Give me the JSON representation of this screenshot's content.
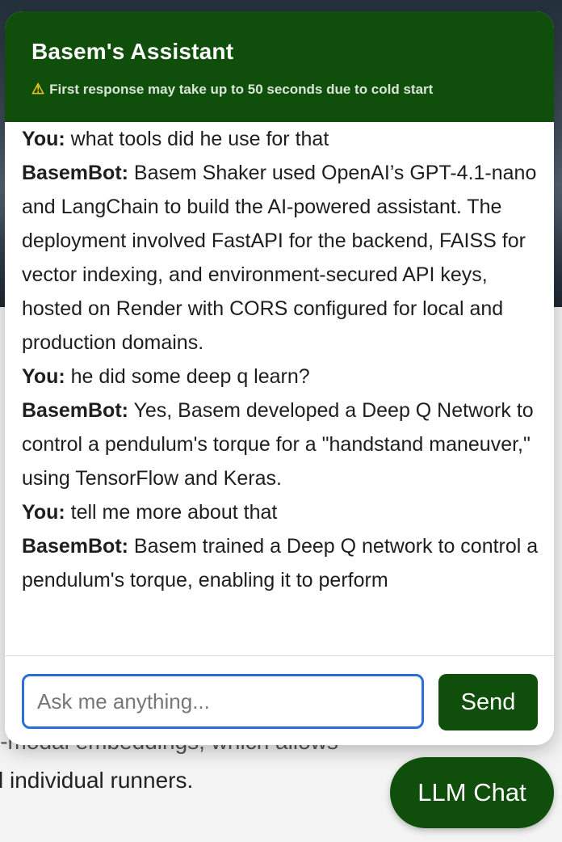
{
  "background": {
    "line_partial": "i-modal embeddings, which allows",
    "line_visible": "l individual runners."
  },
  "chat": {
    "title": "Basem's Assistant",
    "warning_icon": "warning-icon",
    "warning": "First response may take up to 50 seconds due to cold start",
    "messages": [
      {
        "speaker": "You:",
        "text": " what tools did he use for that"
      },
      {
        "speaker": "BasemBot:",
        "text": " Basem Shaker used OpenAI’s GPT-4.1-nano and LangChain to build the AI-powered assistant. The deployment involved FastAPI for the backend, FAISS for vector indexing, and environment-secured API keys, hosted on Render with CORS configured for local and production domains."
      },
      {
        "speaker": "You:",
        "text": " he did some deep q learn?"
      },
      {
        "speaker": "BasemBot:",
        "text": " Yes, Basem developed a Deep Q Network to control a pendulum's torque for a \"handstand maneuver,\" using TensorFlow and Keras."
      },
      {
        "speaker": "You:",
        "text": " tell me more about that"
      },
      {
        "speaker": "BasemBot:",
        "text": " Basem trained a Deep Q network to control a pendulum's torque, enabling it to perform"
      }
    ],
    "input": {
      "value": "",
      "placeholder": "Ask me anything..."
    },
    "send_label": "Send"
  },
  "launcher": {
    "label": "LLM Chat"
  },
  "colors": {
    "brand_green": "#0f4f0b",
    "input_focus_blue": "#2a6fd6",
    "warning_yellow": "#f2c21b"
  }
}
